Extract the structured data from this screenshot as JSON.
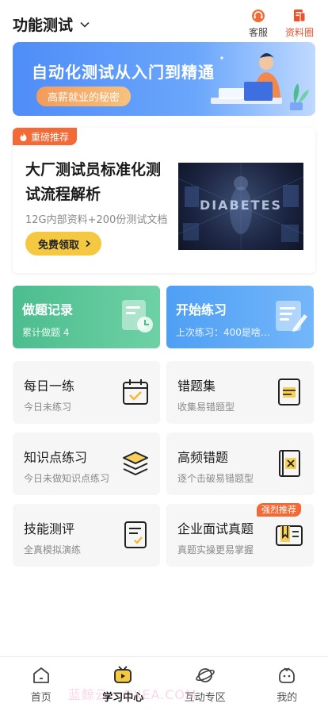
{
  "header": {
    "title": "功能测试",
    "customer_service": "客服",
    "materials": "资料圈"
  },
  "banner": {
    "title": "自动化测试从入门到精通",
    "pill": "高薪就业的秘密"
  },
  "featured": {
    "tag": "重磅推荐",
    "title": "大厂测试员标准化测试流程解析",
    "subtitle": "12G内部资料+200份测试文档",
    "button": "免费领取",
    "image_text": "DIABETES"
  },
  "big_tiles": [
    {
      "title": "做题记录",
      "subtitle": "累计做题 4",
      "icon": "record-icon",
      "color": "#4cbd8e"
    },
    {
      "title": "开始练习",
      "subtitle": "上次练习：400是啥…",
      "icon": "practice-icon",
      "color": "#4e9ff5"
    }
  ],
  "tiles": [
    {
      "title": "每日一练",
      "subtitle": "今日未练习",
      "icon": "calendar-icon"
    },
    {
      "title": "错题集",
      "subtitle": "收集易错题型",
      "icon": "notebook-icon"
    },
    {
      "title": "知识点练习",
      "subtitle": "今日未做知识点练习",
      "icon": "layers-icon"
    },
    {
      "title": "高频错题",
      "subtitle": "逐个击破易错题型",
      "icon": "wrong-book-icon"
    },
    {
      "title": "技能测评",
      "subtitle": "全真模拟演练",
      "icon": "checklist-icon"
    },
    {
      "title": "企业面试真题",
      "subtitle": "真题实操更易掌握",
      "icon": "bookmark-book-icon",
      "badge": "强烈推荐"
    }
  ],
  "nav": [
    {
      "label": "首页",
      "icon": "home-icon"
    },
    {
      "label": "学习中心",
      "icon": "study-center-icon",
      "active": true
    },
    {
      "label": "互动专区",
      "icon": "planet-icon"
    },
    {
      "label": "我的",
      "icon": "profile-icon"
    }
  ],
  "watermark": "蓝鲸云 · CXEA.COM",
  "colors": {
    "accent_orange": "#f36a36",
    "accent_yellow": "#f5c842",
    "green": "#4cbd8e",
    "blue": "#4e9ff5"
  }
}
